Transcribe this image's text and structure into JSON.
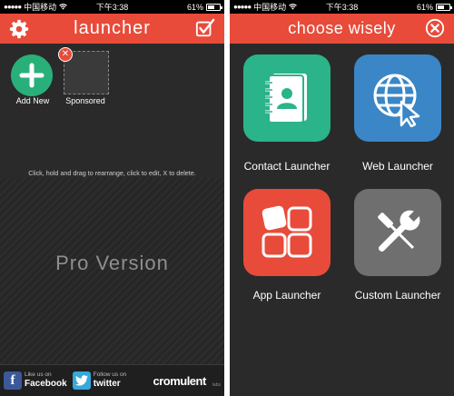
{
  "left_screen": {
    "status": {
      "carrier": "中国移动",
      "time": "下午3:38",
      "battery": "61%",
      "battery_level": 0.61
    },
    "header": {
      "title": "launcher",
      "settings_icon": "gear-icon",
      "done_icon": "checkbox-icon"
    },
    "tiles": [
      {
        "label": "Add New",
        "icon": "plus-icon"
      },
      {
        "label": "Sponsored",
        "badge_icon": "close-badge-icon"
      }
    ],
    "hint": "Click, hold and drag to rearrange, click to edit, X to delete.",
    "pro_label": "Pro Version",
    "footer": {
      "facebook": {
        "small": "Like us on",
        "big": "Facebook"
      },
      "twitter": {
        "small": "Follow us on",
        "big": "twitter"
      },
      "brand": "cromulent",
      "brand_suffix": "labs"
    }
  },
  "right_screen": {
    "status": {
      "carrier": "中国移动",
      "time": "下午3:38",
      "battery": "61%",
      "battery_level": 0.61
    },
    "header": {
      "title": "choose wisely",
      "close_icon": "close-icon"
    },
    "options": [
      {
        "label": "Contact Launcher",
        "icon": "address-book-icon",
        "color": "#2bb38a"
      },
      {
        "label": "Web Launcher",
        "icon": "globe-cursor-icon",
        "color": "#3a86c6"
      },
      {
        "label": "App Launcher",
        "icon": "app-grid-icon",
        "color": "#e84b3a"
      },
      {
        "label": "Custom Launcher",
        "icon": "tools-icon",
        "color": "#6f6f6f"
      }
    ]
  },
  "colors": {
    "accent": "#e84b3a",
    "background": "#2a2a2a"
  }
}
